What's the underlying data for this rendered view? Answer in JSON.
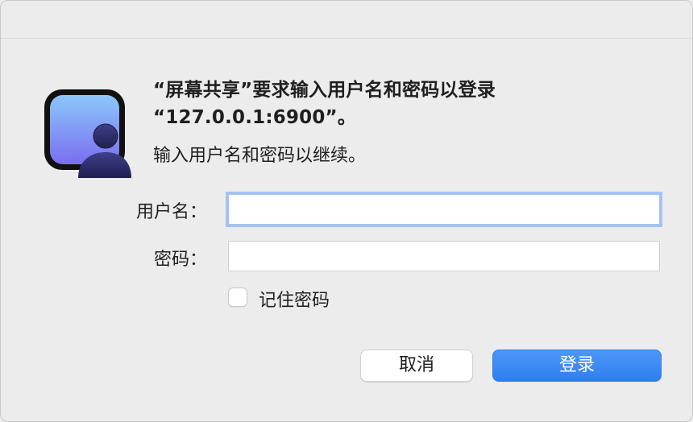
{
  "dialog": {
    "heading_line1": "“屏幕共享”要求输入用户名和密码以登录",
    "heading_line2": "“127.0.0.1:6900”。",
    "subtext": "输入用户名和密码以继续。",
    "app_icon": "screen-sharing-user-icon"
  },
  "form": {
    "username_label": "用户名：",
    "username_value": "",
    "password_label": "密码：",
    "password_value": "",
    "remember_label": "记住密码",
    "remember_checked": false
  },
  "buttons": {
    "cancel_label": "取消",
    "login_label": "登录"
  },
  "colors": {
    "accent": "#2f7ef0",
    "focus_ring": "#a6c2f3",
    "background": "#ececec"
  }
}
